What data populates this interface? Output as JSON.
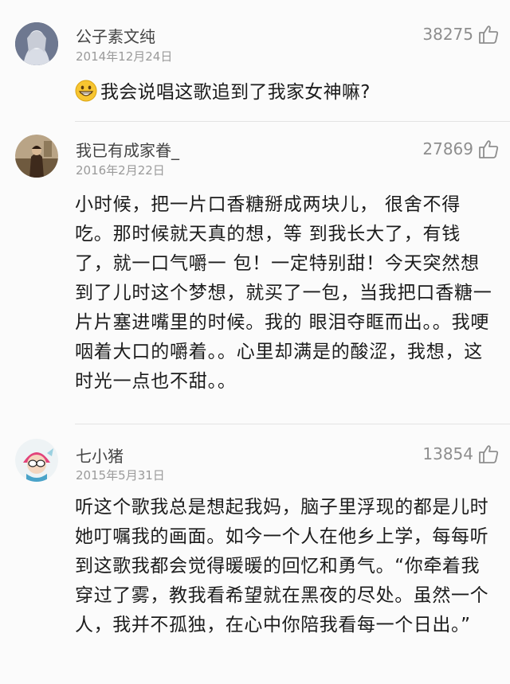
{
  "comments": [
    {
      "username": "公子素文纯",
      "date": "2014年12月24日",
      "likes": "38275",
      "emoji": "grinning-face-emoji",
      "text": "我会说唱这歌追到了我家女神嘛?"
    },
    {
      "username": "我已有成家眷_",
      "date": "2016年2月22日",
      "likes": "27869",
      "text": "小时候，把一片口香糖掰成两块儿， 很舍不得吃。那时候就天真的想，等 到我长大了，有钱了，就一口气嚼一 包！一定特别甜！今天突然想到了儿时这个梦想，就买了一包，当我把口香糖一片片塞进嘴里的时候。我的 眼泪夺眶而出。。我哽咽着大口的嚼着。。心里却满是的酸涩，我想，这时光一点也不甜。。"
    },
    {
      "username": "七小猪",
      "date": "2015年5月31日",
      "likes": "13854",
      "text": "听这个歌我总是想起我妈，脑子里浮现的都是儿时她叮嘱我的画面。如今一个人在他乡上学，每每听到这歌我都会觉得暖暖的回忆和勇气。“你牵着我穿过了雾，教我看希望就在黑夜的尽处。虽然一个人，我并不孤独，在心中你陪我看每一个日出。”"
    }
  ],
  "colors": {
    "background": "#fbfbfb",
    "username": "#444444",
    "meta": "#9a9a9a",
    "text": "#1c1c1c",
    "divider": "#e3e3e3"
  },
  "icons": [
    "thumbs-up-icon",
    "grinning-face-emoji"
  ]
}
